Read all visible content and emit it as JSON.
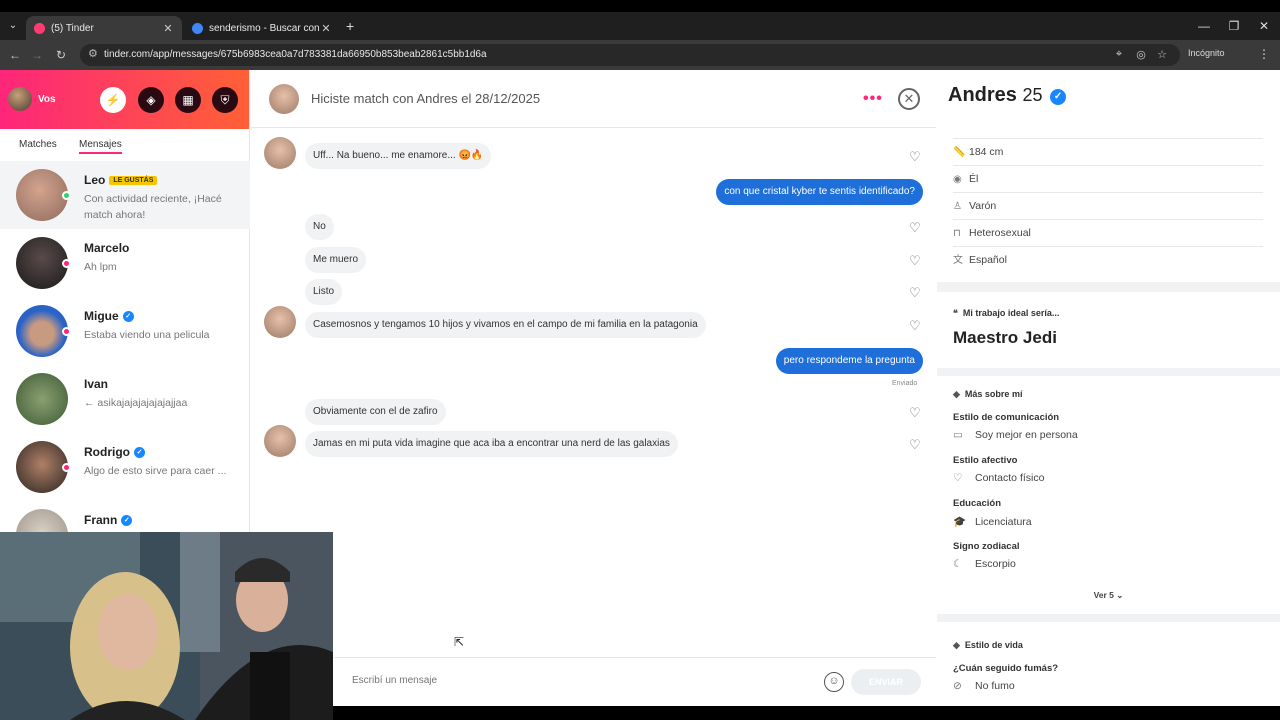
{
  "browser": {
    "tabs": [
      {
        "label": "(5) Tinder",
        "color": "#fe3c72"
      },
      {
        "label": "senderismo - Buscar con Googl",
        "color": "#4285f4"
      }
    ],
    "url": "tinder.com/app/messages/675b6983cea0a7d783381da66950b853beab2861c5bb1d6a",
    "incognito_label": "Incógnito"
  },
  "sidebar": {
    "me_label": "Vos",
    "tabs": [
      "Matches",
      "Mensajes"
    ],
    "conversations": [
      {
        "name": "Leo",
        "badge": "LE GUSTÁS",
        "preview": "Con actividad reciente, ¡Hacé match ahora!",
        "online": "#2bd56a",
        "selected": true
      },
      {
        "name": "Marcelo",
        "preview": "Ah lpm",
        "online": "#fd267a"
      },
      {
        "name": "Migue",
        "verified": true,
        "preview": "Estaba viendo una pelicula",
        "online": "#fd267a"
      },
      {
        "name": "Ivan",
        "preview": "← asikajajajajajajajjaa"
      },
      {
        "name": "Rodrigo",
        "verified": true,
        "preview": "Algo de esto sirve para caer ...",
        "online": "#fd267a"
      },
      {
        "name": "Frann",
        "verified": true,
        "preview": ""
      }
    ]
  },
  "chat": {
    "title": "Hiciste match con Andres el 28/12/2025",
    "messages": [
      {
        "dir": "in",
        "text": "Uff... Na bueno... me enamore... 😡🔥"
      },
      {
        "dir": "out",
        "text": "con que cristal kyber te sentis identificado?"
      },
      {
        "dir": "in",
        "text": "No"
      },
      {
        "dir": "in",
        "text": "Me muero"
      },
      {
        "dir": "in",
        "text": "Listo"
      },
      {
        "dir": "in",
        "text": "Casemosnos y tengamos 10 hijos y vivamos en el campo de mi familia en la patagonia"
      },
      {
        "dir": "out",
        "text": "pero respondeme la pregunta"
      },
      {
        "dir": "in",
        "text": "Obviamente con el de zafiro"
      },
      {
        "dir": "in",
        "text": "Jamas en mi puta vida imagine que aca iba a encontrar una nerd de las galaxias"
      }
    ],
    "sent_label": "Enviado",
    "input_placeholder": "Escribí un mensaje",
    "send_label": "ENVIAR"
  },
  "profile": {
    "name": "Andres",
    "age": "25",
    "basics": [
      "184 cm",
      "Él",
      "Varón",
      "Heterosexual",
      "Español"
    ],
    "ideal_job_title": "Mi trabajo ideal sería...",
    "ideal_job": "Maestro Jedi",
    "more_title": "Más sobre mí",
    "more": [
      {
        "label": "Estilo de comunicación",
        "value": "Soy mejor en persona"
      },
      {
        "label": "Estilo afectivo",
        "value": "Contacto físico"
      },
      {
        "label": "Educación",
        "value": "Licenciatura"
      },
      {
        "label": "Signo zodiacal",
        "value": "Escorpio"
      }
    ],
    "see_more": "Ver 5",
    "lifestyle_title": "Estilo de vida",
    "lifestyle_label": "¿Cuán seguido fumás?",
    "lifestyle_value": "No fumo"
  }
}
